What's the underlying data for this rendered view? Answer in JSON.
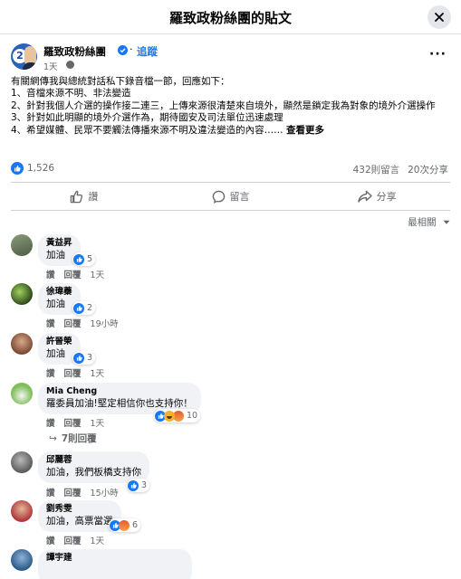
{
  "modal": {
    "title": "羅致政粉絲團的貼文"
  },
  "post": {
    "page_name": "羅致政粉絲團",
    "follow_label": "追蹤",
    "time": "1天",
    "body_lines": [
      "有關網傳我與總統對話私下錄音檔一節，回應如下：",
      "1、音檔來源不明、非法變造",
      "2、針對我個人介選的操作接二連三，上傳來源很清楚來自境外，顯然是鎖定我為對象的境外介選操作",
      "3、針對如此明顯的境外介選作為，期待國安及司法單位迅速處理",
      "4、希望媒體、民眾不要觸法傳播來源不明及違法變造的內容……"
    ],
    "see_more": "查看更多",
    "like_count": "1,526",
    "comment_count": "432則留言",
    "share_count": "20次分享"
  },
  "actions": {
    "like": "讚",
    "comment": "留言",
    "share": "分享"
  },
  "sort_label": "最相關",
  "comments": [
    {
      "name": "黃益昇",
      "text": "加油",
      "reaction_count": "5",
      "like": "讚",
      "reply": "回覆",
      "time": "1天"
    },
    {
      "name": "徐瑋蓁",
      "text": "加油",
      "reaction_count": "2",
      "like": "讚",
      "reply": "回覆",
      "time": "19小時"
    },
    {
      "name": "許晉榮",
      "text": "加油",
      "reaction_count": "3",
      "like": "讚",
      "reply": "回覆",
      "time": "1天"
    },
    {
      "name": "Mia Cheng",
      "text": "羅委員加油!堅定相信你也支持你！",
      "reaction_count": "10",
      "like": "讚",
      "reply": "回覆",
      "time": "1天",
      "replies_label": "7則回覆"
    },
    {
      "name": "邱麗蓉",
      "text": "加油，我們板橋支持你",
      "reaction_count": "3",
      "like": "讚",
      "reply": "回覆",
      "time": "15小時"
    },
    {
      "name": "劉秀雯",
      "text": "加油，高票當選",
      "reaction_count": "6",
      "like": "讚",
      "reply": "回覆",
      "time": "1天"
    },
    {
      "name": "譚宇建",
      "text": ""
    }
  ],
  "colors": {
    "accent": "#1877f2",
    "muted": "#65676b",
    "bubble": "#f0f2f5"
  }
}
